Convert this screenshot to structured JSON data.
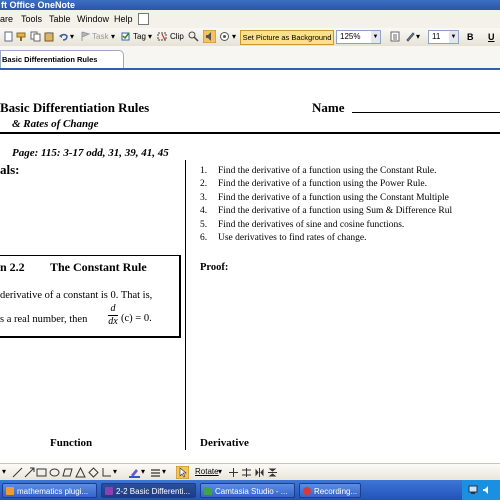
{
  "window": {
    "title": "ft Office OneNote"
  },
  "menu": [
    {
      "label": "are",
      "u": ""
    },
    {
      "label": "Tools",
      "u": "T"
    },
    {
      "label": "Table",
      "u": "a"
    },
    {
      "label": "Window",
      "u": "W"
    },
    {
      "label": "Help",
      "u": "H"
    }
  ],
  "toolbar": {
    "task_label": "Task",
    "tag_label": "Tag",
    "clip_label": "Clip",
    "set_background": "Set Picture as Background",
    "zoom": "125%",
    "font_size": "11",
    "bold": "B",
    "underline": "U"
  },
  "tab": {
    "label": "Basic Differentiation Rules"
  },
  "note": {
    "title": "Basic Differentiation Rules",
    "subtitle": "& Rates of Change",
    "name_label": "Name",
    "page_ref": "Page: 115: 3-17 odd, 31, 39, 41, 45",
    "goals_label": "als:",
    "objectives": [
      {
        "num": "1.",
        "text": "Find the derivative of a function using the Constant Rule."
      },
      {
        "num": "2.",
        "text": "Find the derivative of a function using the Power Rule."
      },
      {
        "num": "3.",
        "text": "Find the derivative of a function using the Constant Multiple"
      },
      {
        "num": "4.",
        "text": "Find the derivative of a function using Sum & Difference Rul"
      },
      {
        "num": "5.",
        "text": "Find the derivatives of sine and cosine functions."
      },
      {
        "num": "6.",
        "text": "Use derivatives to find rates of change."
      }
    ],
    "proof_label": "Proof:",
    "box": {
      "section": "n 2.2",
      "rule_name": "The Constant Rule",
      "line1": "derivative of a constant is 0.  That is,",
      "line2": "s a real number, then",
      "frac_num": "d",
      "frac_den": "dx",
      "expr": "(c) = 0."
    },
    "col_function": "Function",
    "col_derivative": "Derivative"
  },
  "drawing_toolbar": {
    "rotate_label": "Rotate"
  },
  "taskbar": [
    {
      "label": "mathematics plugi...",
      "color": "#f29b2a",
      "active": false
    },
    {
      "label": "2-2 Basic Differenti...",
      "color": "#8e3fb0",
      "active": true
    },
    {
      "label": "Camtasia Studio - ...",
      "color": "#3fa34d",
      "active": false
    },
    {
      "label": "Recording...",
      "color": "#d83a3a",
      "active": false
    }
  ]
}
